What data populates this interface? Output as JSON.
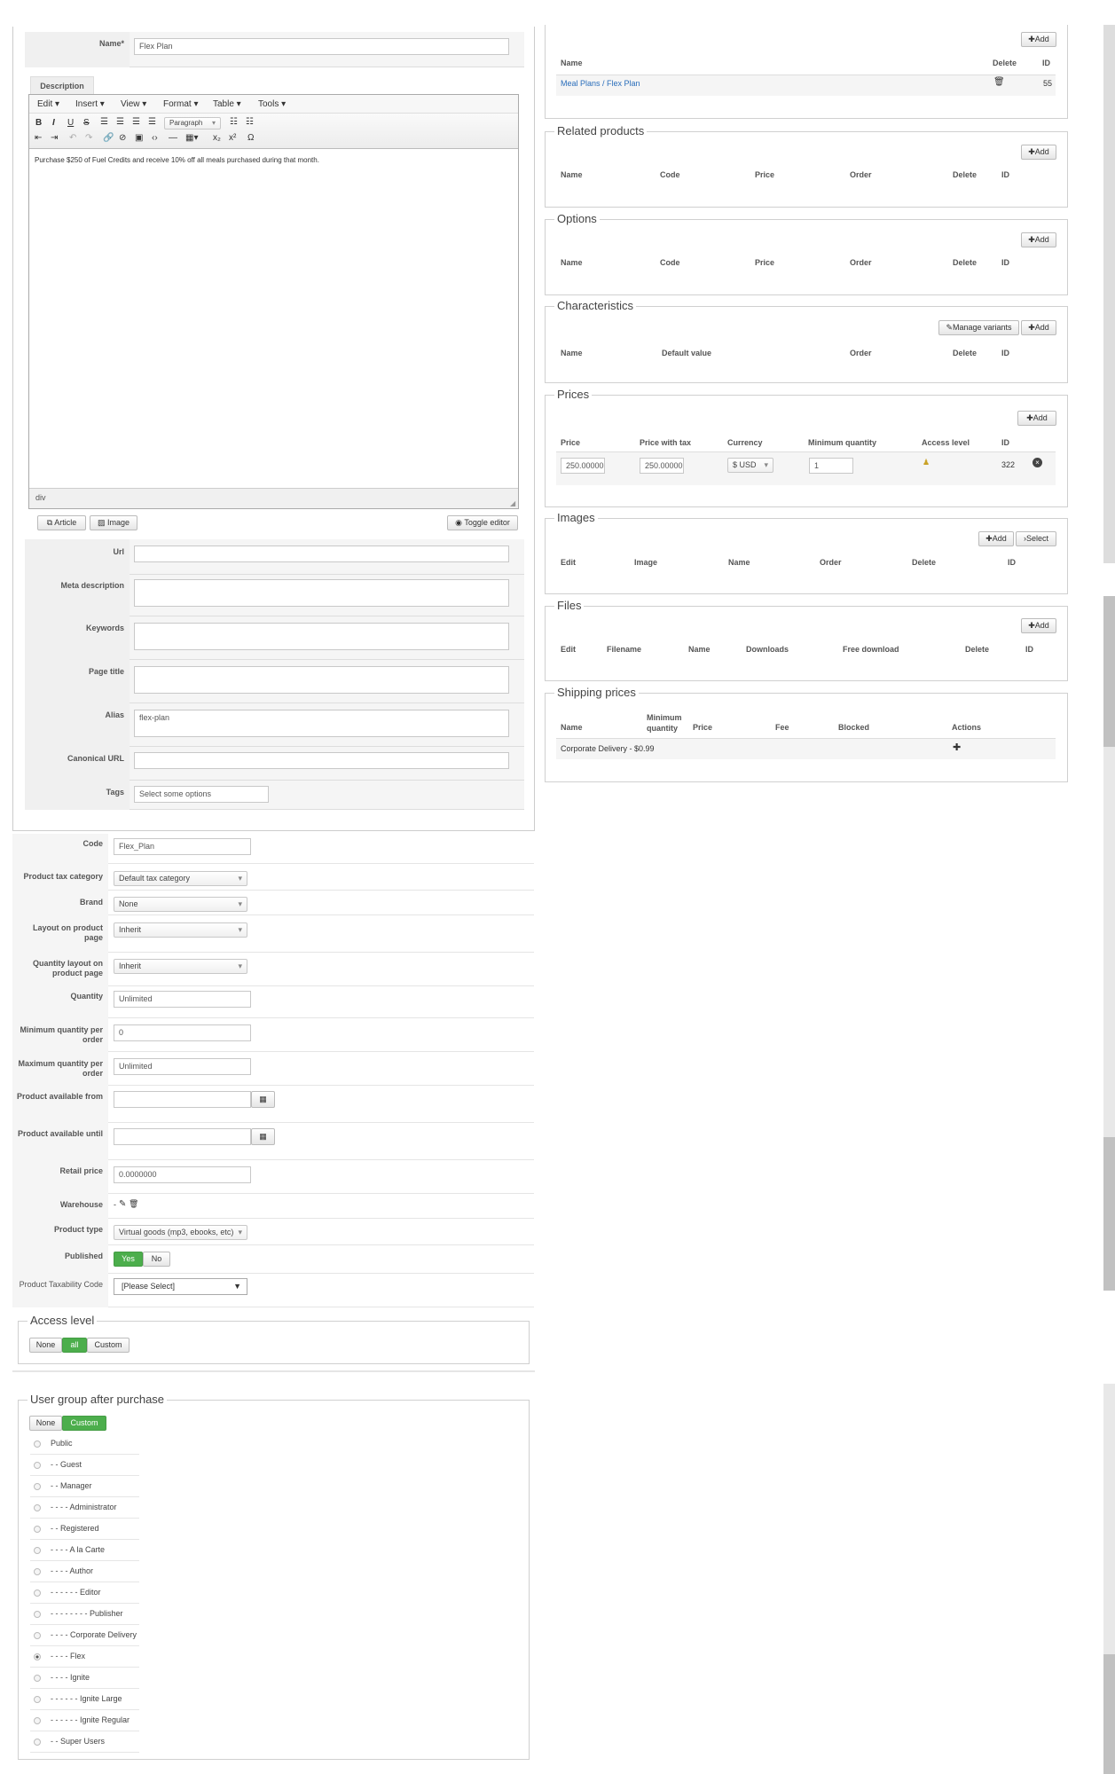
{
  "main": {
    "name_label": "Name*",
    "name_value": "Flex Plan",
    "description_tab": "Description",
    "menubar": [
      "Edit ▾",
      "Insert ▾",
      "View ▾",
      "Format ▾",
      "Table ▾",
      "Tools ▾"
    ],
    "paragraph_select": "Paragraph",
    "editor_text": "Purchase $250 of Fuel Credits and receive 10% off all meals purchased during that month.",
    "editor_status": "div",
    "article_btn": "Article",
    "image_btn": "Image",
    "toggle_btn": "Toggle editor",
    "fields": [
      {
        "label": "Url",
        "value": ""
      },
      {
        "label": "Meta description",
        "value": ""
      },
      {
        "label": "Keywords",
        "value": ""
      },
      {
        "label": "Page title",
        "value": ""
      },
      {
        "label": "Alias",
        "value": "flex-plan"
      },
      {
        "label": "Canonical URL",
        "value": ""
      },
      {
        "label": "Tags",
        "value": "Select some options"
      }
    ]
  },
  "lower": {
    "code_label": "Code",
    "code_value": "Flex_Plan",
    "tax_label": "Product tax category",
    "tax_value": "Default tax category",
    "brand_label": "Brand",
    "brand_value": "None",
    "layout_label": "Layout on product page",
    "layout_value": "Inherit",
    "qlayout_label": "Quantity layout on product page",
    "qlayout_value": "Inherit",
    "quantity_label": "Quantity",
    "quantity_value": "Unlimited",
    "minq_label": "Minimum quantity per order",
    "minq_value": "0",
    "maxq_label": "Maximum quantity per order",
    "maxq_value": "Unlimited",
    "from_label": "Product available from",
    "until_label": "Product available until",
    "retail_label": "Retail price",
    "retail_value": "0.0000000",
    "warehouse_label": "Warehouse",
    "warehouse_value": "-",
    "ptype_label": "Product type",
    "ptype_value": "Virtual goods (mp3, ebooks, etc)",
    "published_label": "Published",
    "yes": "Yes",
    "no": "No",
    "taxcode_label": "Product Taxability Code",
    "taxcode_value": "[Please Select]"
  },
  "access": {
    "legend": "Access level",
    "none": "None",
    "all": "all",
    "custom": "Custom"
  },
  "usergroup": {
    "legend": "User group after purchase",
    "none": "None",
    "custom": "Custom",
    "items": [
      "Public",
      "- - Guest",
      "- - Manager",
      "- - - - Administrator",
      "- - Registered",
      "- - - - A la Carte",
      "- - - - Author",
      "- - - - - - Editor",
      "- - - - - - - - Publisher",
      "- - - - Corporate Delivery",
      "- - - - Flex",
      "- - - - Ignite",
      "- - - - - - Ignite Large",
      "- - - - - - Ignite Regular",
      "- - Super Users"
    ],
    "selected_index": 10
  },
  "right": {
    "add": "Add",
    "category": {
      "name_h": "Name",
      "delete_h": "Delete",
      "id_h": "ID",
      "link": "Meal Plans / Flex Plan",
      "id": "55"
    },
    "related": {
      "legend": "Related products",
      "cols": [
        "Name",
        "Code",
        "Price",
        "Order",
        "Delete",
        "ID"
      ]
    },
    "options": {
      "legend": "Options",
      "cols": [
        "Name",
        "Code",
        "Price",
        "Order",
        "Delete",
        "ID"
      ]
    },
    "characteristics": {
      "legend": "Characteristics",
      "manage": "Manage variants",
      "cols": [
        "Name",
        "Default value",
        "Order",
        "Delete",
        "ID"
      ]
    },
    "prices": {
      "legend": "Prices",
      "cols": [
        "Price",
        "Price with tax",
        "Currency",
        "Minimum quantity",
        "Access level",
        "ID"
      ],
      "price": "250.00000",
      "price_tax": "250.00000",
      "currency": "$ USD",
      "min_qty": "1",
      "id": "322"
    },
    "images": {
      "legend": "Images",
      "select": "Select",
      "cols": [
        "Edit",
        "Image",
        "Name",
        "Order",
        "Delete",
        "ID"
      ]
    },
    "files": {
      "legend": "Files",
      "cols": [
        "Edit",
        "Filename",
        "Name",
        "Downloads",
        "Free download",
        "Delete",
        "ID"
      ]
    },
    "shipping": {
      "legend": "Shipping prices",
      "cols": [
        "Name",
        "Minimum quantity",
        "Price",
        "Fee",
        "Blocked",
        "Actions"
      ],
      "row_name": "Corporate Delivery - $0.99"
    }
  }
}
